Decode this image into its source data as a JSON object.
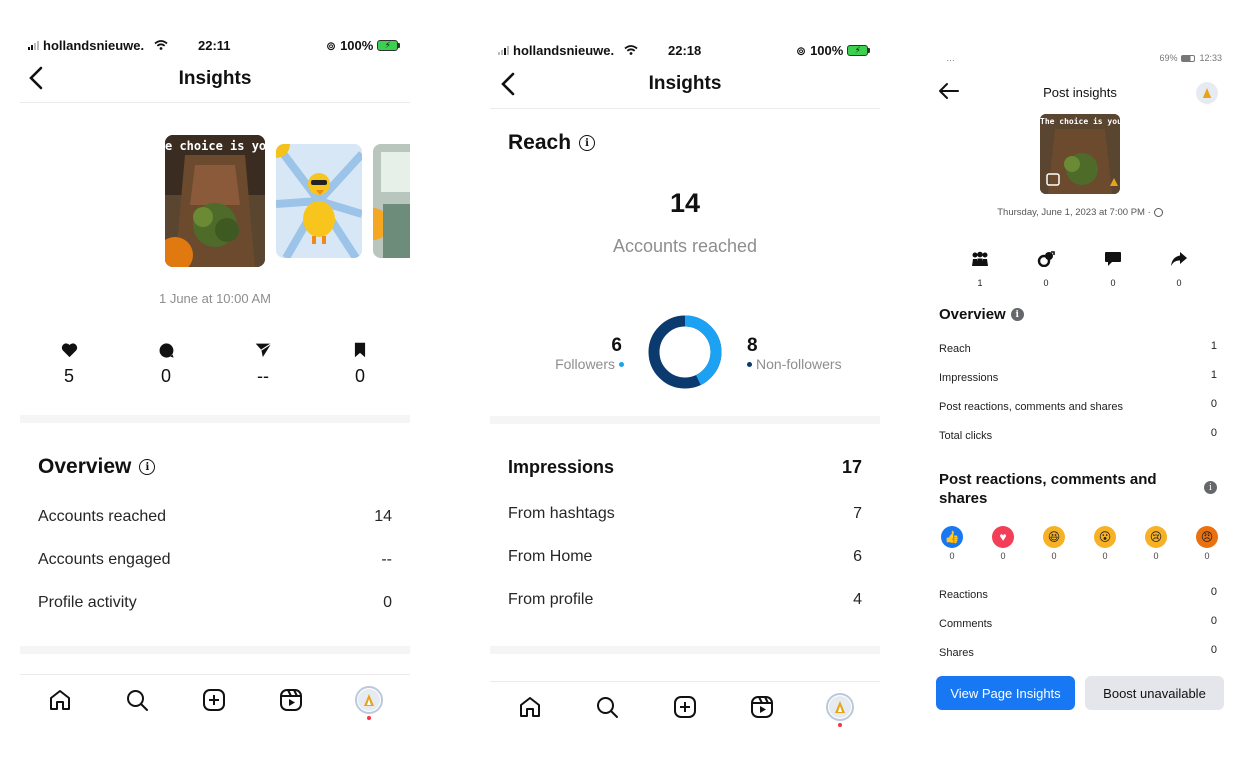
{
  "panel1": {
    "status": {
      "carrier": "hollandsnieuwe.",
      "time": "22:11",
      "battery": "100%"
    },
    "header": {
      "title": "Insights"
    },
    "thumb_caption": "e choice is you",
    "date": "1 June at 10:00 AM",
    "stats": [
      {
        "icon": "heart-icon",
        "value": "5"
      },
      {
        "icon": "comment-icon",
        "value": "0"
      },
      {
        "icon": "send-icon",
        "value": "--"
      },
      {
        "icon": "bookmark-icon",
        "value": "0"
      }
    ],
    "overview": {
      "title": "Overview",
      "rows": [
        {
          "label": "Accounts reached",
          "value": "14"
        },
        {
          "label": "Accounts engaged",
          "value": "--"
        },
        {
          "label": "Profile activity",
          "value": "0"
        }
      ]
    }
  },
  "panel2": {
    "status": {
      "carrier": "hollandsnieuwe.",
      "time": "22:18",
      "battery": "100%"
    },
    "header": {
      "title": "Insights"
    },
    "reach": {
      "title": "Reach",
      "count": "14",
      "subtitle": "Accounts reached",
      "followers_value": "6",
      "followers_label": "Followers",
      "nonfollowers_value": "8",
      "nonfollowers_label": "Non-followers",
      "followers_fraction": 0.4286,
      "followers_color": "#1da1f2",
      "nonfollowers_color": "#0b3a6e"
    },
    "impressions": {
      "title": "Impressions",
      "total": "17",
      "rows": [
        {
          "label": "From hashtags",
          "value": "7"
        },
        {
          "label": "From Home",
          "value": "6"
        },
        {
          "label": "From profile",
          "value": "4"
        }
      ]
    }
  },
  "panel3": {
    "status": {
      "left": "…",
      "battery": "69%",
      "time": "12:33"
    },
    "header": {
      "title": "Post insights"
    },
    "thumb_caption": "The choice is yours",
    "date": "Thursday, June 1, 2023 at 7:00 PM ·",
    "stats": [
      {
        "icon": "reach-people-icon",
        "value": "1"
      },
      {
        "icon": "link-icon",
        "value": "0"
      },
      {
        "icon": "comment-icon",
        "value": "0"
      },
      {
        "icon": "share-icon",
        "value": "0"
      }
    ],
    "overview": {
      "title": "Overview",
      "rows": [
        {
          "label": "Reach",
          "value": "1"
        },
        {
          "label": "Impressions",
          "value": "1"
        },
        {
          "label": "Post reactions, comments and shares",
          "value": "0"
        },
        {
          "label": "Total clicks",
          "value": "0"
        }
      ]
    },
    "reactions_section": {
      "title_line1": "Post reactions, comments and",
      "title_line2": "shares",
      "reactions": [
        {
          "icon": "like-reaction-icon",
          "count": "0",
          "color": "#1877f2"
        },
        {
          "icon": "love-reaction-icon",
          "count": "0",
          "color": "#f33e58"
        },
        {
          "icon": "haha-reaction-icon",
          "count": "0",
          "color": "#f7b125"
        },
        {
          "icon": "wow-reaction-icon",
          "count": "0",
          "color": "#f7b125"
        },
        {
          "icon": "sad-reaction-icon",
          "count": "0",
          "color": "#f7b125"
        },
        {
          "icon": "angry-reaction-icon",
          "count": "0",
          "color": "#e9710f"
        }
      ],
      "rows": [
        {
          "label": "Reactions",
          "value": "0"
        },
        {
          "label": "Comments",
          "value": "0"
        },
        {
          "label": "Shares",
          "value": "0"
        }
      ]
    },
    "buttons": {
      "primary": "View Page Insights",
      "secondary": "Boost unavailable"
    }
  }
}
